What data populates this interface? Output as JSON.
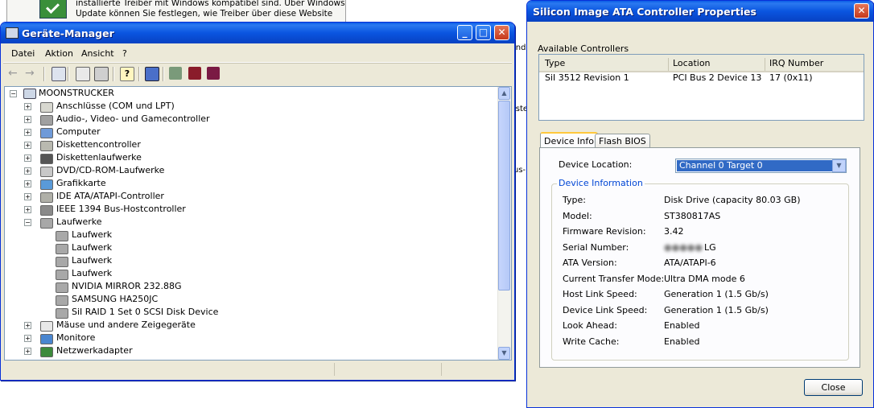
{
  "background_window": {
    "text_line1": "installierte Treiber mit Windows kompatibel sind. Über Windows",
    "text_line2": "Update können Sie festlegen, wie Treiber über diese Website"
  },
  "desktop_fragments": [
    "ind",
    "iste",
    "us-F"
  ],
  "device_manager": {
    "title": "Geräte-Manager",
    "menu": [
      "Datei",
      "Aktion",
      "Ansicht",
      "?"
    ],
    "toolbar_icons": [
      "back-icon",
      "forward-icon",
      "console-tree-icon",
      "properties-icon",
      "print-icon",
      "help-icon",
      "scan-hardware-icon",
      "update-driver-icon",
      "uninstall-icon",
      "disable-icon"
    ],
    "root": "MOONSTRUCKER",
    "tree": [
      {
        "label": "Anschlüsse (COM und LPT)",
        "level": 1,
        "expander": "+",
        "icon": "port-icon"
      },
      {
        "label": "Audio-, Video- und Gamecontroller",
        "level": 1,
        "expander": "+",
        "icon": "audio-icon"
      },
      {
        "label": "Computer",
        "level": 1,
        "expander": "+",
        "icon": "computer-icon"
      },
      {
        "label": "Diskettencontroller",
        "level": 1,
        "expander": "+",
        "icon": "floppy-controller-icon"
      },
      {
        "label": "Diskettenlaufwerke",
        "level": 1,
        "expander": "+",
        "icon": "floppy-drive-icon"
      },
      {
        "label": "DVD/CD-ROM-Laufwerke",
        "level": 1,
        "expander": "+",
        "icon": "cdrom-icon"
      },
      {
        "label": "Grafikkarte",
        "level": 1,
        "expander": "+",
        "icon": "display-adapter-icon"
      },
      {
        "label": "IDE ATA/ATAPI-Controller",
        "level": 1,
        "expander": "+",
        "icon": "ide-controller-icon"
      },
      {
        "label": "IEEE 1394 Bus-Hostcontroller",
        "level": 1,
        "expander": "+",
        "icon": "firewire-icon"
      },
      {
        "label": "Laufwerke",
        "level": 1,
        "expander": "−",
        "icon": "disk-drive-icon"
      },
      {
        "label": "Laufwerk",
        "level": 2,
        "expander": "",
        "icon": "disk-drive-icon"
      },
      {
        "label": "Laufwerk",
        "level": 2,
        "expander": "",
        "icon": "disk-drive-icon"
      },
      {
        "label": "Laufwerk",
        "level": 2,
        "expander": "",
        "icon": "disk-drive-icon"
      },
      {
        "label": "Laufwerk",
        "level": 2,
        "expander": "",
        "icon": "disk-drive-icon"
      },
      {
        "label": "NVIDIA  MIRROR   232.88G",
        "level": 2,
        "expander": "",
        "icon": "disk-drive-icon"
      },
      {
        "label": "SAMSUNG HA250JC",
        "level": 2,
        "expander": "",
        "icon": "disk-drive-icon"
      },
      {
        "label": "SiI RAID 1 Set 0 SCSI Disk Device",
        "level": 2,
        "expander": "",
        "icon": "disk-drive-icon"
      },
      {
        "label": "Mäuse und andere Zeigegeräte",
        "level": 1,
        "expander": "+",
        "icon": "mouse-icon"
      },
      {
        "label": "Monitore",
        "level": 1,
        "expander": "+",
        "icon": "monitor-icon"
      },
      {
        "label": "Netzwerkadapter",
        "level": 1,
        "expander": "+",
        "icon": "network-adapter-icon"
      }
    ]
  },
  "properties": {
    "title": "Silicon Image ATA Controller Properties",
    "available_label": "Available Controllers",
    "columns": [
      "Type",
      "Location",
      "IRQ Number"
    ],
    "rows": [
      [
        "SiI 3512 Revision 1",
        "PCI Bus 2 Device 13",
        "17 (0x11)"
      ]
    ],
    "tabs": [
      "Device Info",
      "Flash BIOS"
    ],
    "device_location_label": "Device Location:",
    "device_location_value": "Channel 0   Target 0",
    "group_title": "Device Information",
    "info": [
      {
        "key": "Type:",
        "value": "Disk Drive (capacity 80.03 GB)"
      },
      {
        "key": "Model:",
        "value": "ST380817AS"
      },
      {
        "key": "Firmware Revision:",
        "value": "3.42"
      },
      {
        "key": "Serial Number:",
        "value": "LG"
      },
      {
        "key": "ATA Version:",
        "value": "ATA/ATAPI-6"
      },
      {
        "key": "Current Transfer Mode:",
        "value": "Ultra DMA mode 6"
      },
      {
        "key": "Host Link Speed:",
        "value": "Generation 1 (1.5 Gb/s)"
      },
      {
        "key": "Device Link Speed:",
        "value": "Generation 1 (1.5 Gb/s)"
      },
      {
        "key": "Look Ahead:",
        "value": "Enabled"
      },
      {
        "key": "Write Cache:",
        "value": "Enabled"
      }
    ],
    "close_label": "Close"
  },
  "colors": {
    "title_bar": "#0a55e0",
    "dialog_bg": "#ece9d8",
    "selection": "#316ac5"
  }
}
